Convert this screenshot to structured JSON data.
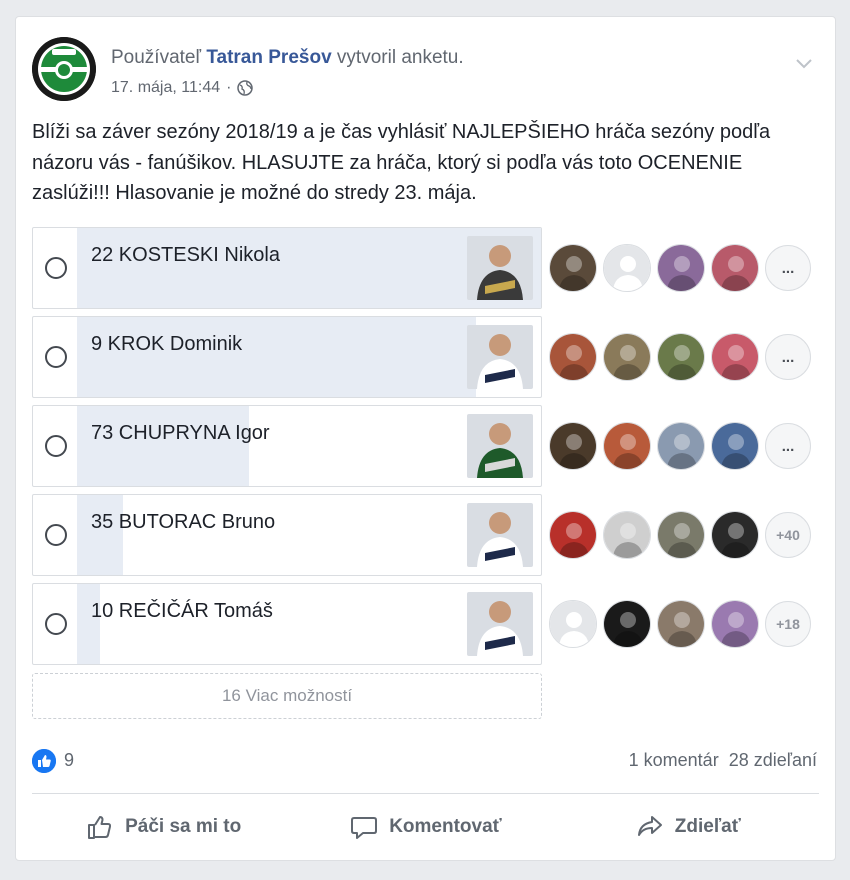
{
  "header": {
    "prefix": "Používateľ",
    "page_name": "Tatran Prešov",
    "suffix": "vytvoril anketu.",
    "timestamp": "17. mája, 11:44",
    "separator": "·",
    "privacy_icon": "globe-icon",
    "menu_icon": "chevron-down-icon"
  },
  "post": {
    "text": "Blíži sa záver sezóny 2018/19 a je čas vyhlásiť NAJLEPŠIEHO hráča sezóny podľa názoru vás - fanúšikov. HLASUJTE za hráča, ktorý si podľa vás toto OCENENIE zaslúži!!! Hlasovanie je možné do stredy 23. mája."
  },
  "poll": {
    "options": [
      {
        "label": "22 KOSTESKI Nikola",
        "vote_share": 1.0,
        "more": "...",
        "thumb_colors": [
          "#3a3a3a",
          "#c8a84e"
        ],
        "voter_colors": [
          "#5a4a3a",
          "#e4e6e9",
          "#8a6a9a",
          "#b85a6a"
        ]
      },
      {
        "label": "9 KROK Dominik",
        "vote_share": 0.86,
        "more": "...",
        "thumb_colors": [
          "#ffffff",
          "#1e2a4a"
        ],
        "voter_colors": [
          "#a8553a",
          "#8a7a5a",
          "#6a7a4a",
          "#c85a6a"
        ]
      },
      {
        "label": "73 CHUPRYNA Igor",
        "vote_share": 0.37,
        "more": "...",
        "thumb_colors": [
          "#1e5a2a",
          "#d8d8d8"
        ],
        "voter_colors": [
          "#4a3a2a",
          "#b85a3a",
          "#8a9ab0",
          "#4a6a9a"
        ]
      },
      {
        "label": "35 BUTORAC Bruno",
        "vote_share": 0.1,
        "more": "+40",
        "thumb_colors": [
          "#ffffff",
          "#1e2a4a"
        ],
        "voter_colors": [
          "#b8302a",
          "#cfcfcf",
          "#7a7a6a",
          "#2a2a2a"
        ]
      },
      {
        "label": "10 REČIČÁR Tomáš",
        "vote_share": 0.05,
        "more": "+18",
        "thumb_colors": [
          "#ffffff",
          "#1e2a4a"
        ],
        "voter_colors": [
          "#e4e6e9",
          "#1a1a1a",
          "#8a7a6a",
          "#9a7ab0"
        ]
      }
    ],
    "more_options": "16 Viac možností"
  },
  "stats": {
    "likes": "9",
    "comments": "1 komentár",
    "shares": "28 zdieľaní"
  },
  "actions": {
    "like": "Páči sa mi to",
    "comment": "Komentovať",
    "share": "Zdieľať"
  },
  "colors": {
    "link": "#385898",
    "bar": "#e7ecf4",
    "like_blue": "#1877f2"
  }
}
